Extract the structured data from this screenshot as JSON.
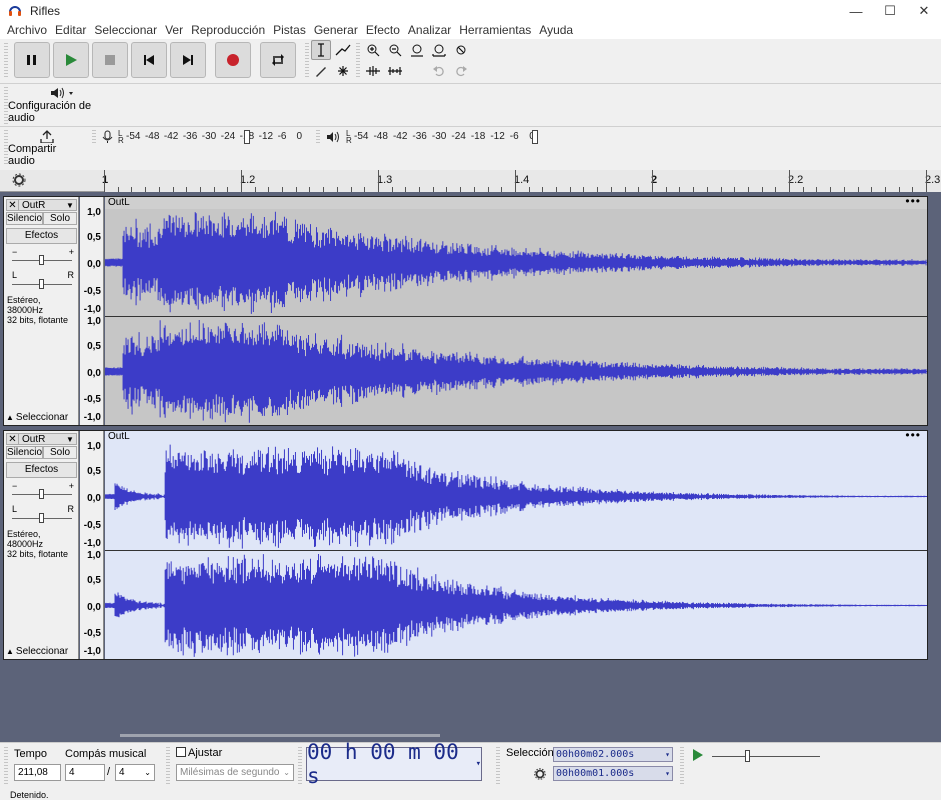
{
  "window": {
    "title": "Rifles",
    "minimize": "—",
    "maximize": "☐",
    "close": "✕"
  },
  "menu": [
    "Archivo",
    "Editar",
    "Seleccionar",
    "Ver",
    "Reproducción",
    "Pistas",
    "Generar",
    "Efecto",
    "Analizar",
    "Herramientas",
    "Ayuda"
  ],
  "toolbar": {
    "audio_setup_label": "Configuración de audio",
    "share_label": "Compartir audio"
  },
  "meters": {
    "record_ticks": [
      "-54",
      "-48",
      "-42",
      "-36",
      "-30",
      "-24",
      "-18",
      "-12",
      "-6",
      "0"
    ],
    "play_ticks": [
      "-54",
      "-48",
      "-42",
      "-36",
      "-30",
      "-24",
      "-18",
      "-12",
      "-6",
      "0"
    ],
    "lr": [
      "L",
      "R"
    ]
  },
  "ruler": {
    "labels": [
      "1",
      "1.2",
      "1.3",
      "1.4",
      "2",
      "2.2",
      "2.3"
    ],
    "bold": [
      "1",
      "2"
    ]
  },
  "tracks": [
    {
      "name": "OutR",
      "mute": "Silencio",
      "solo": "Solo",
      "effects": "Efectos",
      "info1": "Estéreo, 38000Hz",
      "info2": "32 bits, flotante",
      "select": "Seleccionar",
      "clip": "OutL",
      "scale": [
        "1,0",
        "0,5",
        "0,0",
        "-0,5",
        "-1,0"
      ],
      "selected": true
    },
    {
      "name": "OutR",
      "mute": "Silencio",
      "solo": "Solo",
      "effects": "Efectos",
      "info1": "Estéreo, 48000Hz",
      "info2": "32 bits, flotante",
      "select": "Seleccionar",
      "clip": "OutL",
      "scale": [
        "1,0",
        "0,5",
        "0,0",
        "-0,5",
        "-1,0"
      ],
      "selected": false
    }
  ],
  "bottom": {
    "tempo_label": "Tempo",
    "tempo_value": "211,08",
    "meter_label": "Compás musical",
    "meter_num": "4",
    "meter_sep": "/",
    "meter_den": "4",
    "snap_label": "Ajustar",
    "snap_unit": "Milésimas de segundo",
    "time": "00 h 00 m 00 s",
    "selection_label": "Selección",
    "sel_start": "00h00m02.000s",
    "sel_end": "00h00m01.000s"
  },
  "status": "Detenido."
}
